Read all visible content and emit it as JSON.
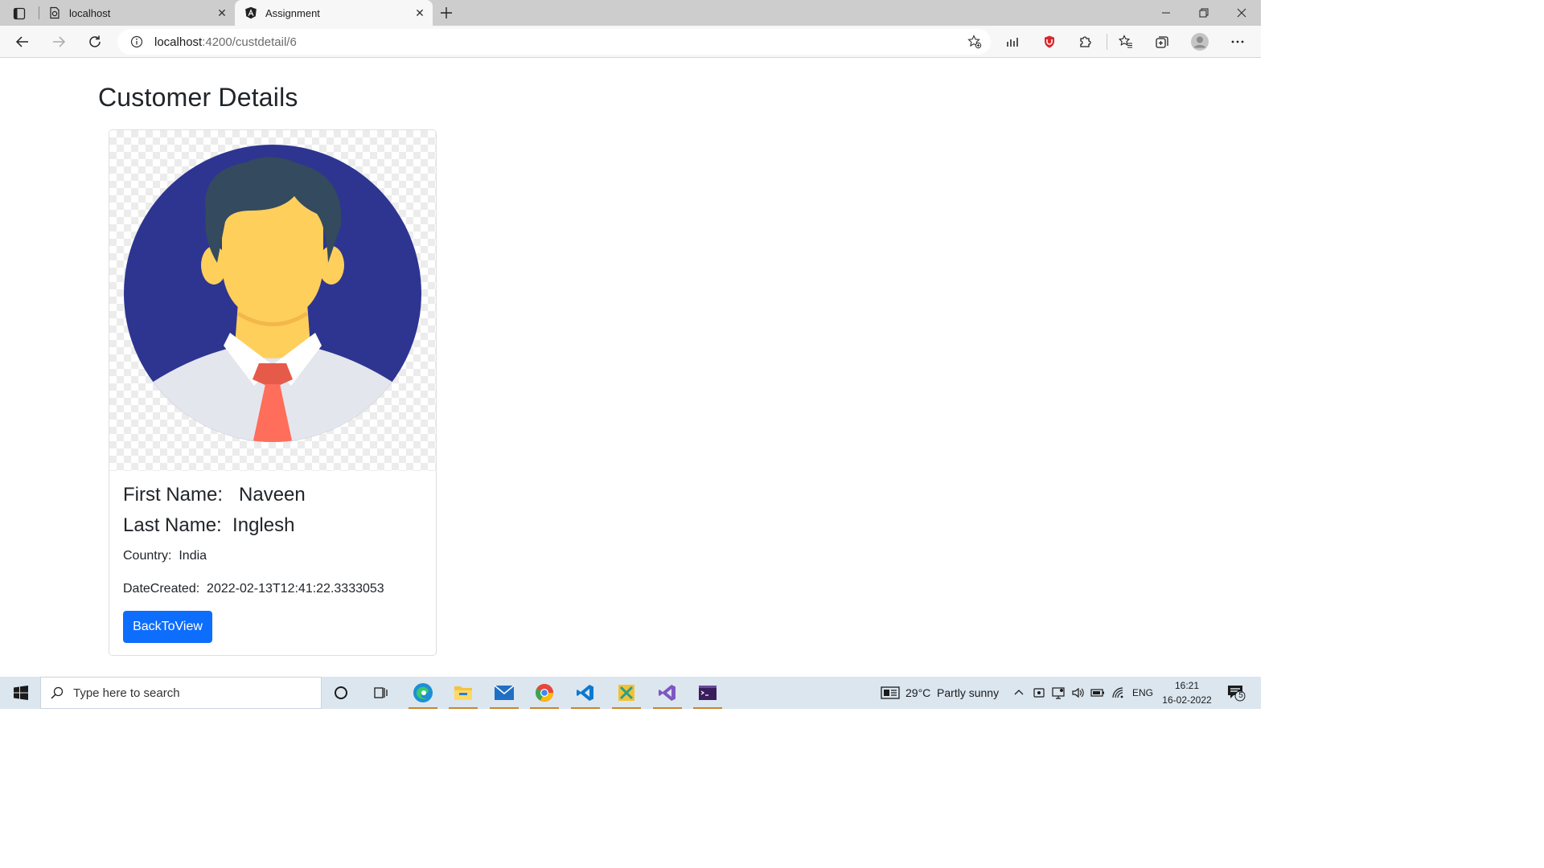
{
  "browser": {
    "tabs": [
      {
        "title": "localhost",
        "favicon": "page-icon",
        "active": false
      },
      {
        "title": "Assignment",
        "favicon": "angular-icon",
        "active": true
      }
    ],
    "address": {
      "host": "localhost",
      "path": ":4200/custdetail/6"
    }
  },
  "page": {
    "heading": "Customer Details",
    "avatar_icon": "male-avatar-icon",
    "customer": {
      "first_name": "First Name:   Naveen",
      "last_name": "Last Name:  Inglesh",
      "country": "Country:  India",
      "date_created": "DateCreated:  2022-02-13T12:41:22.3333053"
    },
    "back_button": "BackToView",
    "accent_color": "#0d6efd"
  },
  "taskbar": {
    "search_placeholder": "Type here to search",
    "weather": "29°C  Partly sunny",
    "language": "ENG",
    "time": "16:21",
    "date": "16-02-2022",
    "notification_count": "5"
  }
}
